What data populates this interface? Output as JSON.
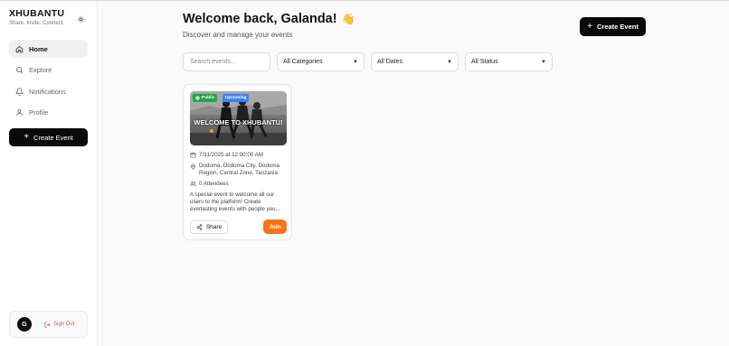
{
  "brand": {
    "name": "XHUBANTU",
    "tagline": "Share. Invite. Connect."
  },
  "sidebar": {
    "items": [
      {
        "label": "Home",
        "icon": "home-icon",
        "active": true
      },
      {
        "label": "Explore",
        "icon": "search-icon",
        "active": false
      },
      {
        "label": "Notifications",
        "icon": "bell-icon",
        "active": false
      },
      {
        "label": "Profile",
        "icon": "user-icon",
        "active": false
      }
    ],
    "create_label": "Create Event"
  },
  "user": {
    "initial": "G",
    "signout_label": "Sign Out"
  },
  "main": {
    "title": "Welcome back, Galanda!",
    "wave": "👋",
    "subtitle": "Discover and manage your events",
    "create_label": "Create Event"
  },
  "filters": {
    "search_placeholder": "Search events...",
    "category": "All Categories",
    "dates": "All Dates",
    "status": "All Status"
  },
  "event": {
    "badge_public": "Public",
    "badge_upcoming": "Upcoming",
    "image_caption": "WELCOME TO XHUBANTU!",
    "datetime": "7/31/2025 at 12:00:00 AM",
    "location": "Dodoma, Dodoma City, Dodoma Region, Central Zone, Tanzania",
    "attendees": "0 Attendees",
    "description": "A special event to welcome all our users to the platform! Create everlasting events with people you...",
    "share_label": "Share",
    "join_label": "Join"
  },
  "colors": {
    "accent": "#f97316",
    "primary": "#0a0a0a",
    "public": "#22a447",
    "upcoming": "#3b82f6",
    "danger": "#e5484d"
  }
}
